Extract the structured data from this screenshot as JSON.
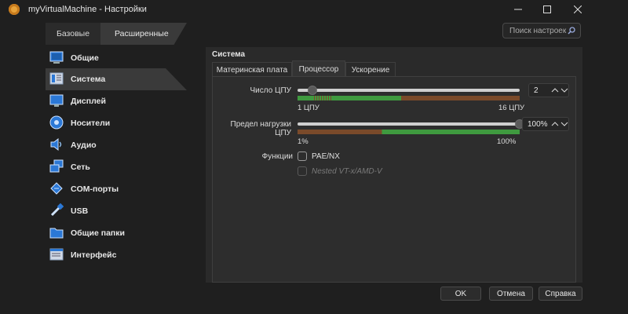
{
  "window": {
    "title": "myVirtualMachine - Настройки"
  },
  "mode_tabs": {
    "basic": "Базовые",
    "advanced": "Расширенные"
  },
  "search": {
    "placeholder": "Поиск настроек"
  },
  "sidebar": {
    "items": [
      {
        "label": "Общие",
        "icon": "general-icon"
      },
      {
        "label": "Система",
        "icon": "system-icon",
        "active": true
      },
      {
        "label": "Дисплей",
        "icon": "display-icon"
      },
      {
        "label": "Носители",
        "icon": "storage-icon"
      },
      {
        "label": "Аудио",
        "icon": "audio-icon"
      },
      {
        "label": "Сеть",
        "icon": "network-icon"
      },
      {
        "label": "COM-порты",
        "icon": "serial-port-icon"
      },
      {
        "label": "USB",
        "icon": "usb-icon"
      },
      {
        "label": "Общие папки",
        "icon": "shared-folder-icon"
      },
      {
        "label": "Интерфейс",
        "icon": "interface-icon"
      }
    ]
  },
  "section": {
    "title": "Система"
  },
  "subtabs": [
    "Материнская плата",
    "Процессор",
    "Ускорение"
  ],
  "cpu": {
    "label": "Число ЦПУ",
    "value": "2",
    "min_label": "1 ЦПУ",
    "max_label": "16 ЦПУ",
    "min": 1,
    "max": 16,
    "current": 2
  },
  "cap": {
    "label": "Предел нагрузки ЦПУ",
    "value": "100%",
    "min_label": "1%",
    "max_label": "100%",
    "min": 1,
    "max": 100,
    "current": 100
  },
  "features": {
    "label": "Функции",
    "pae": "PAE/NX",
    "nested": "Nested VT-x/AMD-V"
  },
  "buttons": {
    "ok": "OK",
    "cancel": "Отмена",
    "help": "Справка"
  },
  "colors": {
    "green": "#3f9a3f",
    "brown": "#7a4a2a",
    "accent": "#2b78d6"
  }
}
